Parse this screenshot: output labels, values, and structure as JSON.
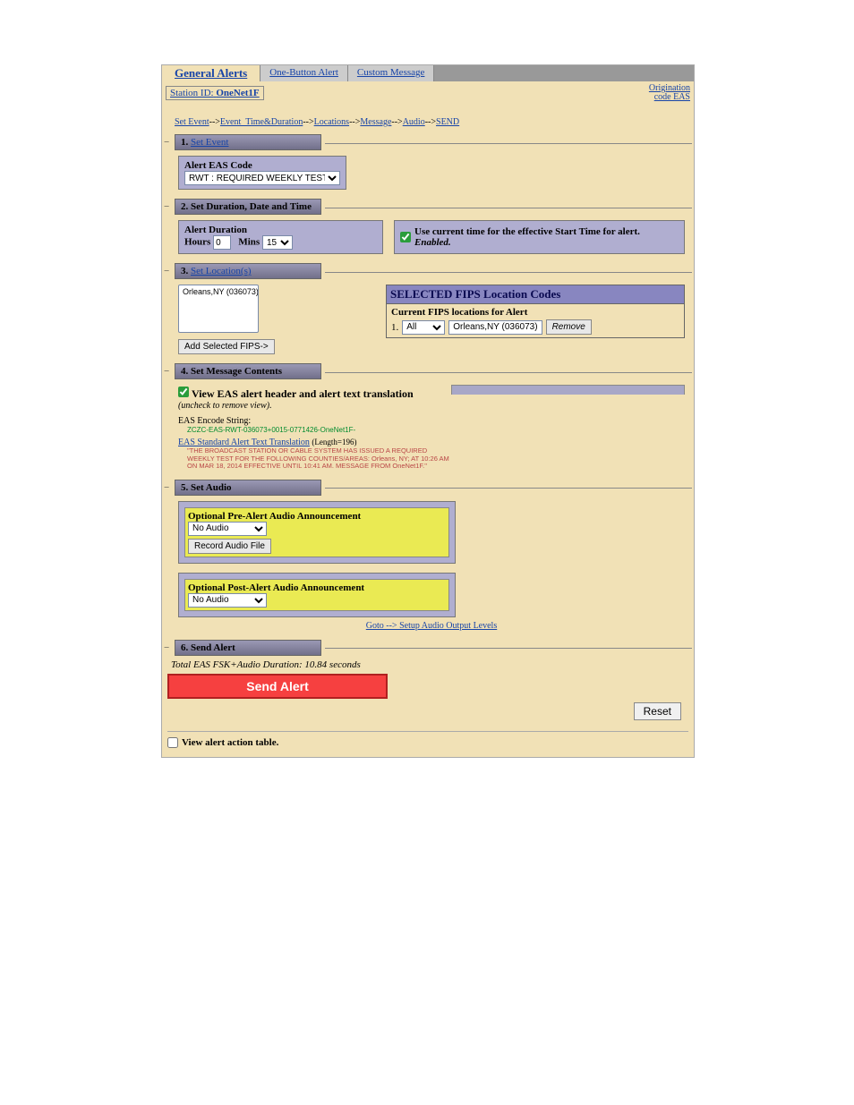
{
  "tabs": {
    "active": "General Alerts",
    "one_button": "One-Button Alert",
    "custom": "Custom Message"
  },
  "station": {
    "label": "Station ID:",
    "value": "OneNet1F"
  },
  "origination": {
    "line1": "Origination",
    "line2": "code EAS"
  },
  "crumbs": {
    "set_event": "Set Event",
    "event_time": "Event_Time&Duration",
    "locations": "Locations",
    "message": "Message",
    "audio": "Audio",
    "send": "SEND",
    "sep": "-->"
  },
  "sections": {
    "s1_num": "1.",
    "s1_title": "Set Event",
    "s2_title": "2. Set Duration, Date and Time",
    "s3_num": "3.",
    "s3_title": "Set Location(s)",
    "s4_title": "4. Set Message Contents",
    "s5_title": "5. Set Audio",
    "s6_title": "6. Send Alert"
  },
  "event": {
    "label": "Alert EAS Code",
    "value": "RWT : REQUIRED WEEKLY TEST"
  },
  "duration": {
    "label": "Alert Duration",
    "hours_label": "Hours",
    "hours_value": "0",
    "mins_label": "Mins",
    "mins_value": "15",
    "use_current_label": "Use current time for the effective Start Time for alert.",
    "enabled_suffix": "Enabled."
  },
  "locations": {
    "list_item": "Orleans,NY (036073)",
    "add_btn": "Add Selected FIPS->",
    "selected_header": "SELECTED FIPS Location Codes",
    "current_label": "Current FIPS locations for Alert",
    "row_num": "1.",
    "subdiv_value": "All",
    "fips_display": "Orleans,NY (036073)",
    "remove_btn": "Remove"
  },
  "message": {
    "view_checkbox_label": "View EAS alert header and alert text translation",
    "uncheck_note": "(uncheck to remove view).",
    "encode_label": "EAS Encode String:",
    "encode_value": "ZCZC-EAS-RWT-036073+0015-0771426-OneNet1F-",
    "translation_link": "EAS Standard Alert Text Translation",
    "length_suffix": "(Length=196)",
    "translation_body": "\"THE BROADCAST STATION OR CABLE SYSTEM HAS ISSUED A REQUIRED WEEKLY TEST FOR THE FOLLOWING COUNTIES/AREAS: Orleans, NY; AT 10:26 AM ON MAR 18, 2014 EFFECTIVE UNTIL 10:41 AM. MESSAGE FROM OneNet1F.\""
  },
  "audio": {
    "pre_label": "Optional Pre-Alert Audio Announcement",
    "pre_value": "No Audio",
    "record_btn": "Record Audio File",
    "post_label": "Optional Post-Alert Audio Announcement",
    "post_value": "No Audio",
    "goto_link": "Goto --> Setup Audio Output Levels"
  },
  "send": {
    "total_dur": "Total EAS FSK+Audio Duration: 10.84 seconds",
    "send_btn": "Send Alert",
    "reset_btn": "Reset"
  },
  "footer": {
    "view_action_table": "View alert action table."
  }
}
